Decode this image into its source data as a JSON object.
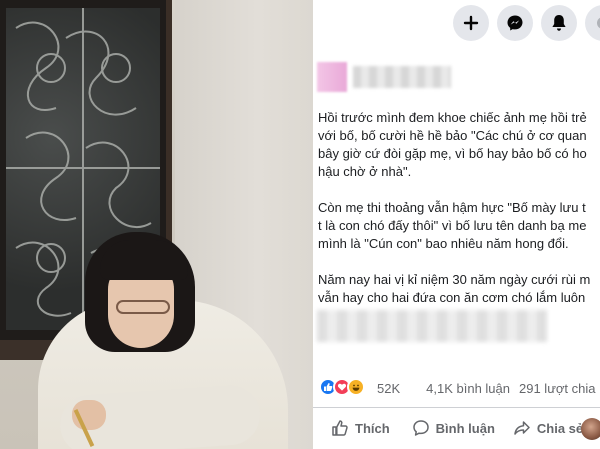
{
  "header": {
    "buttons": [
      {
        "name": "create-button",
        "icon": "plus-icon"
      },
      {
        "name": "messenger-button",
        "icon": "messenger-icon"
      },
      {
        "name": "notifications-button",
        "icon": "bell-icon"
      }
    ]
  },
  "post": {
    "paragraphs": [
      [
        "Hồi trước mình đem khoe chiếc ảnh mẹ hồi trẻ",
        "với bố, bố cười hề hề bảo \"Các chú ở cơ quan",
        "bây giờ cứ đòi gặp mẹ, vì bố hay bảo bố có ho",
        "hậu chờ ở nhà\"."
      ],
      [
        "Còn mẹ thi thoảng vẫn hậm hực \"Bố mày lưu t",
        "t là con chó đấy thôi\" vì bố lưu tên danh bạ me",
        "mình là \"Cún con\" bao nhiêu năm hong đổi."
      ],
      [
        "Năm nay hai vị kỉ niệm 30 năm ngày cưới rùi m",
        "vẫn hay cho hai đứa con ăn cơm chó lắm luôn"
      ]
    ]
  },
  "stats": {
    "reaction_icons": [
      "like-icon",
      "love-icon",
      "haha-icon"
    ],
    "reactions_count": "52K",
    "comments": "4,1K bình luận",
    "shares": "291 lượt chia"
  },
  "actions": {
    "like_label": "Thích",
    "comment_label": "Bình luận",
    "share_label": "Chia sẻ"
  },
  "colors": {
    "like_blue": "#1877f2",
    "love_red": "#f33e58",
    "haha_yellow": "#f7b125",
    "secondary_text": "#65676b",
    "button_bg": "#e4e6eb"
  }
}
